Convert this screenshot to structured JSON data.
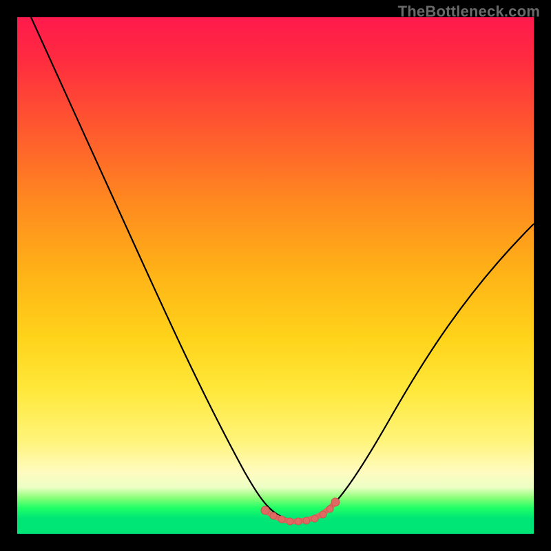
{
  "watermark": {
    "text": "TheBottleneck.com"
  },
  "colors": {
    "gradient_top": "#ff1a4d",
    "gradient_mid": "#ffd31a",
    "gradient_bottom": "#00e676",
    "curve_stroke": "#000000",
    "marker_fill": "#df6a63",
    "marker_stroke": "#c75850",
    "frame": "#000000"
  },
  "chart_data": {
    "type": "line",
    "title": "",
    "xlabel": "",
    "ylabel": "",
    "xlim": [
      0,
      100
    ],
    "ylim": [
      0,
      100
    ],
    "annotations": [
      "TheBottleneck.com"
    ],
    "series": [
      {
        "name": "bottleneck-curve",
        "x": [
          0,
          5,
          10,
          15,
          20,
          25,
          30,
          35,
          40,
          45,
          48,
          50,
          52,
          54,
          56,
          58,
          60,
          62,
          65,
          70,
          75,
          80,
          85,
          90,
          95,
          100
        ],
        "values": [
          100,
          90,
          80,
          70,
          60,
          50,
          41,
          32,
          23,
          14,
          9,
          6,
          4,
          3,
          2,
          3,
          4,
          6,
          10,
          18,
          26,
          34,
          41,
          48,
          54,
          60
        ]
      }
    ],
    "markers": {
      "name": "flat-bottom-markers",
      "x": [
        49,
        50,
        51,
        52,
        53,
        54,
        55,
        56,
        57,
        58,
        59,
        60
      ],
      "values": [
        6,
        4.8,
        4.0,
        3.4,
        3.0,
        2.8,
        2.8,
        3.0,
        3.4,
        4.2,
        5.4,
        7.0
      ]
    }
  }
}
